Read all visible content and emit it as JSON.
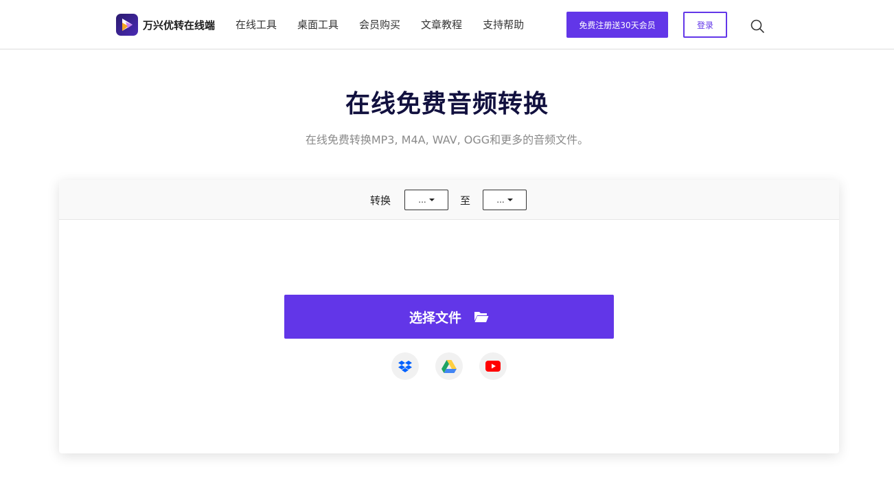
{
  "header": {
    "logo_text": "万兴优转在线端",
    "nav": [
      "在线工具",
      "桌面工具",
      "会员购买",
      "文章教程",
      "支持帮助"
    ],
    "signup_label": "免费注册送30天会员",
    "login_label": "登录"
  },
  "hero": {
    "title": "在线免费音频转换",
    "subtitle": "在线免费转换MP3, M4A, WAV, OGG和更多的音频文件。"
  },
  "converter": {
    "convert_label": "转换",
    "from_value": "...",
    "to_label": "至",
    "to_value": "...",
    "choose_label": "选择文件"
  },
  "sources": [
    {
      "icon": "dropbox-icon",
      "color": "#0061fe"
    },
    {
      "icon": "google-drive-icon",
      "color": "#1fa463"
    },
    {
      "icon": "youtube-icon",
      "color": "#ff0000"
    }
  ],
  "colors": {
    "accent": "#6236e8",
    "title": "#12113f"
  }
}
